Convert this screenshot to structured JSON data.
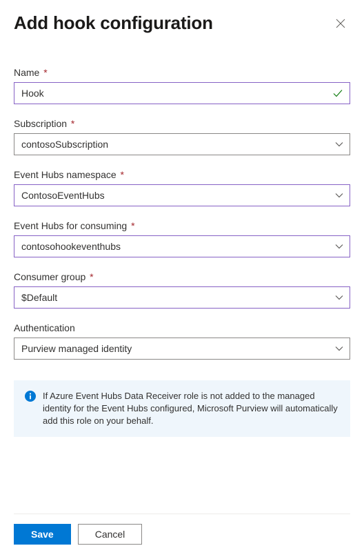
{
  "header": {
    "title": "Add hook configuration"
  },
  "form": {
    "name": {
      "label": "Name",
      "value": "Hook"
    },
    "subscription": {
      "label": "Subscription",
      "value": "contosoSubscription"
    },
    "eventHubsNamespace": {
      "label": "Event Hubs namespace",
      "value": "ContosoEventHubs"
    },
    "eventHubsConsuming": {
      "label": "Event Hubs for consuming",
      "value": "contosohookeventhubs"
    },
    "consumerGroup": {
      "label": "Consumer group",
      "value": "$Default"
    },
    "authentication": {
      "label": "Authentication",
      "value": "Purview managed identity"
    }
  },
  "info": {
    "text": "If Azure Event Hubs Data Receiver role is not added to the managed identity for the Event Hubs configured, Microsoft Purview will automatically add this role on your behalf."
  },
  "footer": {
    "save": "Save",
    "cancel": "Cancel"
  }
}
